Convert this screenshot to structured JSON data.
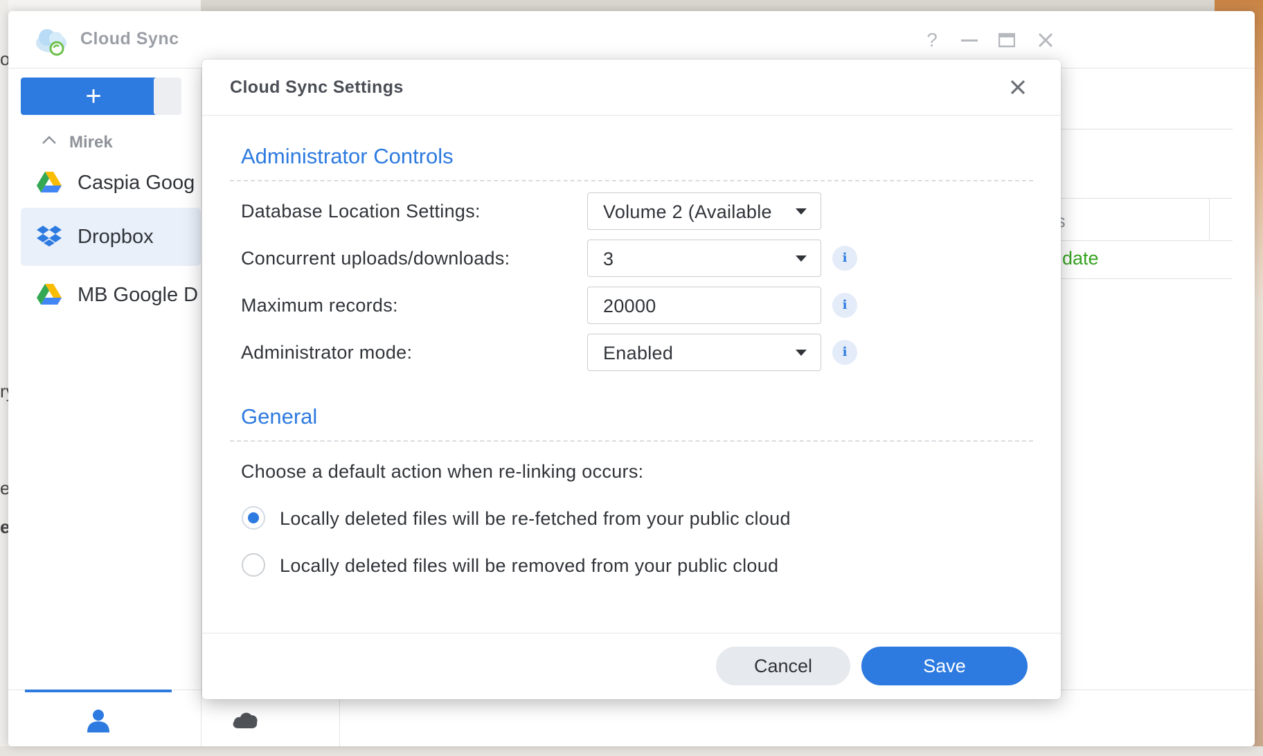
{
  "desktop": {
    "left_fragments": [
      "of",
      "ry",
      "e",
      "er"
    ]
  },
  "app": {
    "title": "Cloud Sync",
    "window_controls": [
      "help-icon",
      "minimize-icon",
      "maximize-icon",
      "close-icon"
    ],
    "sidebar": {
      "add_button_label": "+",
      "group_label": "Mirek",
      "items": [
        {
          "label": "Caspia Goog",
          "icon": "google-drive-icon"
        },
        {
          "label": "Dropbox",
          "icon": "dropbox-icon",
          "active": true
        },
        {
          "label": "MB Google D",
          "icon": "google-drive-icon"
        }
      ],
      "bottom_tabs": [
        {
          "icon": "user-icon",
          "active": true
        },
        {
          "icon": "cloud-icon",
          "active": false
        }
      ]
    },
    "background_table": {
      "column_header_fragment": "tus",
      "status_fragment": "to date"
    }
  },
  "dialog": {
    "title": "Cloud Sync Settings",
    "sections": {
      "admin": {
        "title": "Administrator Controls",
        "fields": {
          "db_location": {
            "label": "Database Location Settings:",
            "value": "Volume 2 (Available"
          },
          "concurrent": {
            "label": "Concurrent uploads/downloads:",
            "value": "3"
          },
          "max_records": {
            "label": "Maximum records:",
            "value": "20000"
          },
          "admin_mode": {
            "label": "Administrator mode:",
            "value": "Enabled"
          }
        },
        "info_glyph": "i"
      },
      "general": {
        "title": "General",
        "prompt": "Choose a default action when re-linking occurs:",
        "options": [
          {
            "label": "Locally deleted files will be re-fetched from your public cloud",
            "selected": true
          },
          {
            "label": "Locally deleted files will be removed from your public cloud",
            "selected": false
          }
        ]
      }
    },
    "buttons": {
      "cancel": "Cancel",
      "save": "Save"
    }
  },
  "colors": {
    "accent": "#2d7ae0",
    "status_green": "#36a320",
    "text": "#303338"
  }
}
